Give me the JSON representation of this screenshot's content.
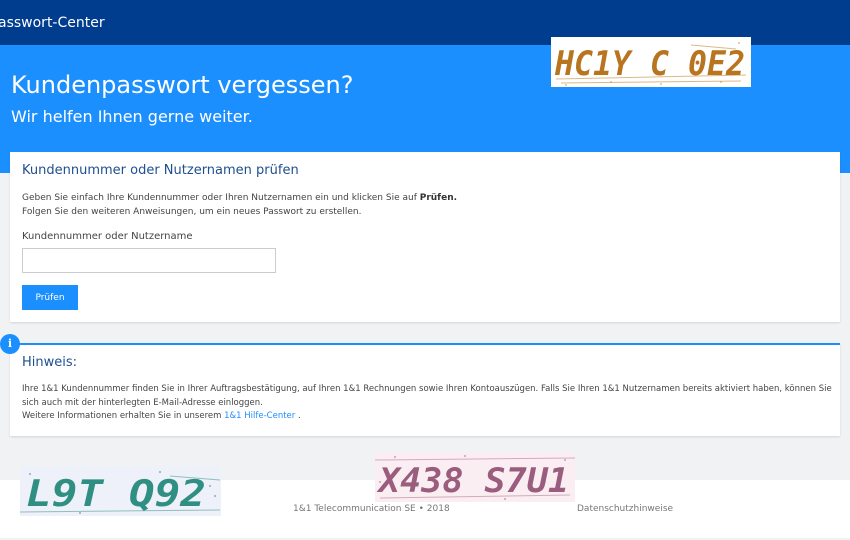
{
  "header": {
    "brand": "asswort-Center"
  },
  "hero": {
    "title": "Kundenpasswort vergessen?",
    "subtitle": "Wir helfen Ihnen gerne weiter."
  },
  "check_card": {
    "title": "Kundennummer oder Nutzernamen prüfen",
    "desc_line1_pre": "Geben Sie einfach Ihre Kundennummer oder Ihren Nutzernamen ein und klicken Sie auf ",
    "desc_line1_bold": "Prüfen.",
    "desc_line2": "Folgen Sie den weiteren Anweisungen, um ein neues Passwort zu erstellen.",
    "field_label": "Kundennummer oder Nutzername",
    "field_value": "",
    "button_label": "Prüfen"
  },
  "notice_card": {
    "icon": "i",
    "title": "Hinweis:",
    "text1": "Ihre 1&1 Kundennummer finden Sie in Ihrer Auftragsbestätigung, auf Ihren 1&1 Rechnungen sowie Ihren Kontoauszügen. Falls Sie Ihren 1&1 Nutzernamen bereits aktiviert haben, können Sie sich auch mit der hinterlegten E-Mail-Adresse einloggen.",
    "text2_pre": "Weitere Informationen erhalten Sie in unserem ",
    "link": "1&1 Hilfe-Center",
    "text2_post": " ."
  },
  "footer": {
    "copyright": "1&1 Telecommunication SE • 2018",
    "privacy": "Datenschutzhinweise"
  },
  "captchas": [
    {
      "text": "HC1Y C 0E2",
      "color": "#b8741f"
    },
    {
      "text": "L9T Q92",
      "color": "#2f8f82"
    },
    {
      "text": "X438 S7U1",
      "color": "#9a5d7e"
    }
  ]
}
